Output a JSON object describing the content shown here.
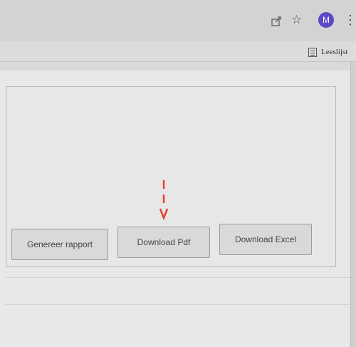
{
  "browser": {
    "avatar_initial": "M",
    "avatar_color": "#5b48c4",
    "icons": [
      "share-icon",
      "star-icon",
      "kebab-menu-icon"
    ],
    "reading_list_label": "Leeslijst"
  },
  "report_panel": {
    "buttons": {
      "generate_report": "Genereer rapport",
      "download_pdf": "Download Pdf",
      "download_excel": "Download Excel"
    },
    "annotation_color": "#e8412a"
  }
}
